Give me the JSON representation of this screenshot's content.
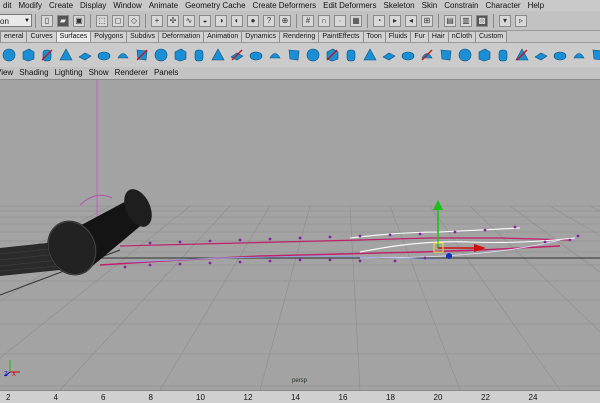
{
  "menubar": {
    "items": [
      "dit",
      "Modify",
      "Create",
      "Display",
      "Window",
      "Animate",
      "Geometry Cache",
      "Create Deformers",
      "Edit Deformers",
      "Skeleton",
      "Skin",
      "Constrain",
      "Character",
      "Help"
    ]
  },
  "statusline": {
    "mode_value": "on"
  },
  "shelf_tabs": {
    "items": [
      "eneral",
      "Curves",
      "Surfaces",
      "Polygons",
      "Subdivs",
      "Deformation",
      "Animation",
      "Dynamics",
      "Rendering",
      "PaintEffects",
      "Toon",
      "Fluids",
      "Fur",
      "Hair",
      "nCloth",
      "Custom"
    ],
    "active": "Surfaces"
  },
  "shelf": {
    "icon_names": [
      "sphere-icon",
      "cube-icon",
      "cylinder-icon",
      "cone-icon",
      "plane-icon",
      "torus-icon",
      "circle-icon",
      "square-icon",
      "revolve-icon",
      "loft-icon",
      "planar-icon",
      "extrude-icon",
      "birail-icon",
      "boundary-icon",
      "square-surface-icon",
      "bevel-icon",
      "bevel-plus-icon",
      "intersect-icon",
      "project-curve-icon",
      "trim-icon",
      "untrim-icon",
      "attach-icon",
      "detach-icon",
      "align-icon",
      "open-close-icon",
      "insert-isoparm-icon",
      "extend-icon",
      "offset-icon",
      "rebuild-icon",
      "reverse-icon",
      "round-icon",
      "stitch-icon",
      "sculpt-icon",
      "surface-fillet-icon"
    ]
  },
  "panel_menu": {
    "items": [
      "View",
      "Shading",
      "Lighting",
      "Show",
      "Renderer",
      "Panels"
    ]
  },
  "viewport": {
    "label": "persp",
    "axis_x": "X",
    "axis_z": "Z"
  },
  "timeline": {
    "ticks": [
      "2",
      "4",
      "6",
      "8",
      "10",
      "12",
      "14",
      "16",
      "18",
      "20",
      "22",
      "24"
    ]
  },
  "colors": {
    "viewport_bg": "#a3a3a3",
    "grid": "#8a8a8a",
    "selected_curve": "#c0206a",
    "highlight_curve": "#ffffff",
    "shelf_icon_blue": "#1a8fd6",
    "manip_y": "#18c018",
    "manip_x": "#d01010"
  }
}
